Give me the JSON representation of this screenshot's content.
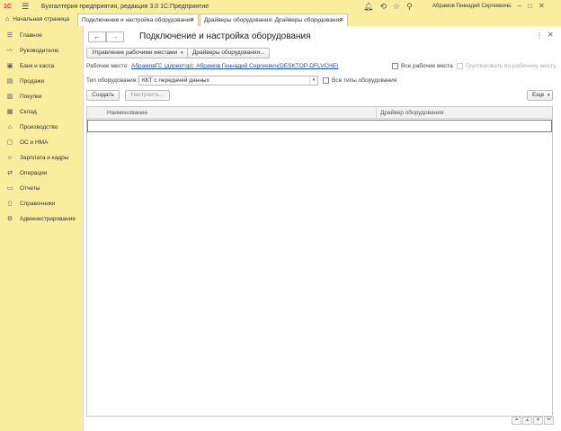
{
  "titlebar": {
    "logo": "1С",
    "app_title": "Бухгалтерия предприятия, редакция 3.0 1С:Предприятие",
    "user_name": "Абрамов Геннадий Сергеевич"
  },
  "tabs": [
    {
      "label": "Начальная страница",
      "icon": "home-icon"
    },
    {
      "label": "Подключение и настройка оборудования",
      "close": "×"
    },
    {
      "label": "Драйверы оборудования: Драйверы оборудования",
      "close": "×"
    }
  ],
  "sidebar": {
    "items": [
      {
        "label": "Главное",
        "icon": "menu-icon"
      },
      {
        "label": "Руководителю",
        "icon": "chart-line-icon"
      },
      {
        "label": "Банк и касса",
        "icon": "bank-icon"
      },
      {
        "label": "Продажи",
        "icon": "cart-icon"
      },
      {
        "label": "Покупки",
        "icon": "basket-icon"
      },
      {
        "label": "Склад",
        "icon": "warehouse-icon"
      },
      {
        "label": "Производство",
        "icon": "factory-icon"
      },
      {
        "label": "ОС и НМА",
        "icon": "assets-icon"
      },
      {
        "label": "Зарплата и кадры",
        "icon": "people-icon"
      },
      {
        "label": "Операции",
        "icon": "operations-icon"
      },
      {
        "label": "Отчеты",
        "icon": "reports-icon"
      },
      {
        "label": "Справочники",
        "icon": "book-icon"
      },
      {
        "label": "Администрирование",
        "icon": "gear-icon"
      }
    ]
  },
  "main": {
    "title": "Подключение и настройка оборудования",
    "back": "←",
    "forward": "→",
    "toolbar": {
      "manage_workplaces": "Управление рабочими местами",
      "drivers": "Драйверы оборудования..."
    },
    "workplace": {
      "label": "Рабочее место:",
      "value": "АбрамовГС (директор): Абрамов Геннадий Сергеевич(DESKTOP-DFLVCHE)",
      "all_workplaces": "Все рабочие места",
      "group_by_workplace": "Группировать по рабочему месту"
    },
    "equipment_type": {
      "label": "Тип оборудования:",
      "value": "ККТ с передачей данных",
      "all_types": "Все типы оборудования"
    },
    "actions": {
      "create": "Создать",
      "configure": "Настроить...",
      "more": "Еще"
    },
    "table": {
      "columns": [
        "Наименование",
        "Драйвер оборудования"
      ]
    }
  }
}
